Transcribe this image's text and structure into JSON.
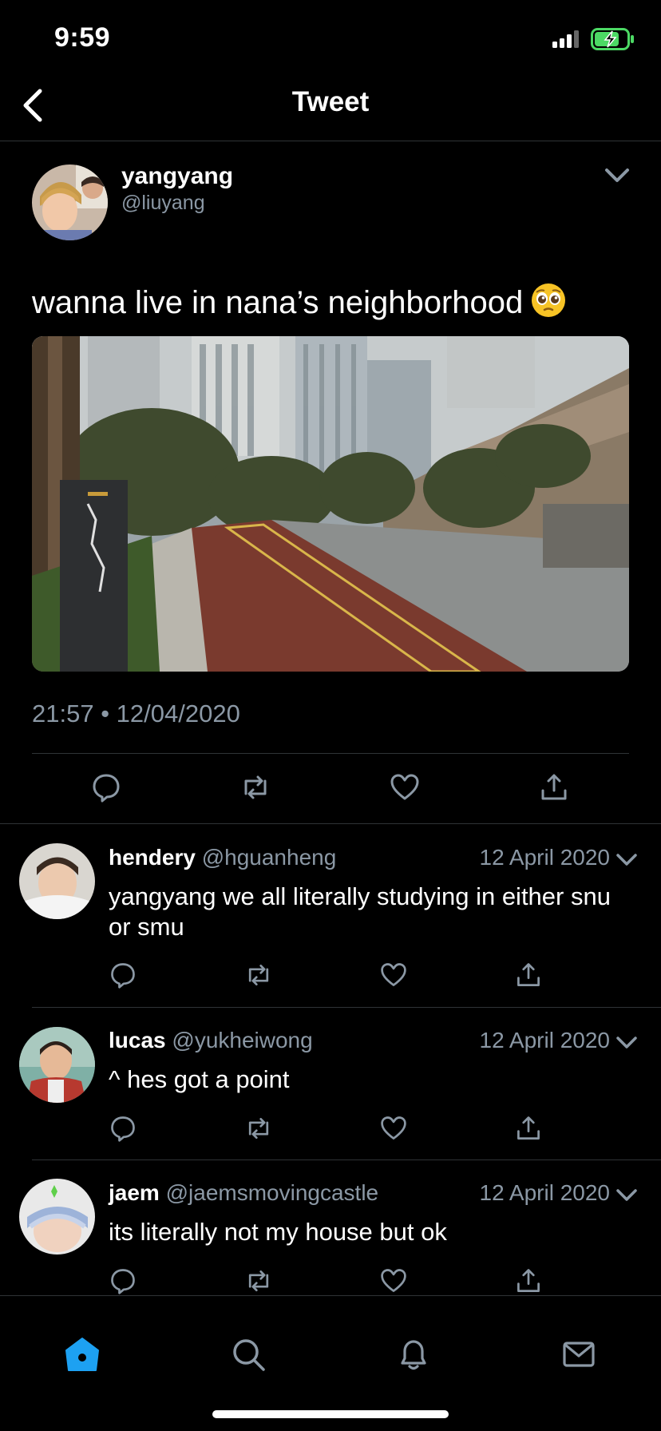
{
  "status_bar": {
    "time": "9:59"
  },
  "header": {
    "title": "Tweet"
  },
  "tweet": {
    "name": "yangyang",
    "handle": "@liuyang",
    "text": "wanna live in nana’s neighborhood",
    "emoji": "pleading-face",
    "timestamp": "21:57 • 12/04/2020"
  },
  "replies": [
    {
      "name": "hendery",
      "handle": "@hguanheng",
      "date": "12 April 2020",
      "text": "yangyang we all literally studying in either snu or smu"
    },
    {
      "name": "lucas",
      "handle": "@yukheiwong",
      "date": "12 April 2020",
      "text": "^ hes got a point"
    },
    {
      "name": "jaem",
      "handle": "@jaemsmovingcastle",
      "date": "12 April 2020",
      "text": "its literally not my house but ok"
    }
  ],
  "tab_bar": {
    "active": "home",
    "items": [
      "home",
      "search",
      "notifications",
      "messages"
    ]
  },
  "colors": {
    "background": "#000000",
    "muted": "#8b98a5",
    "accent": "#1da1f2",
    "divider": "#2f3336",
    "battery": "#4cd964"
  }
}
